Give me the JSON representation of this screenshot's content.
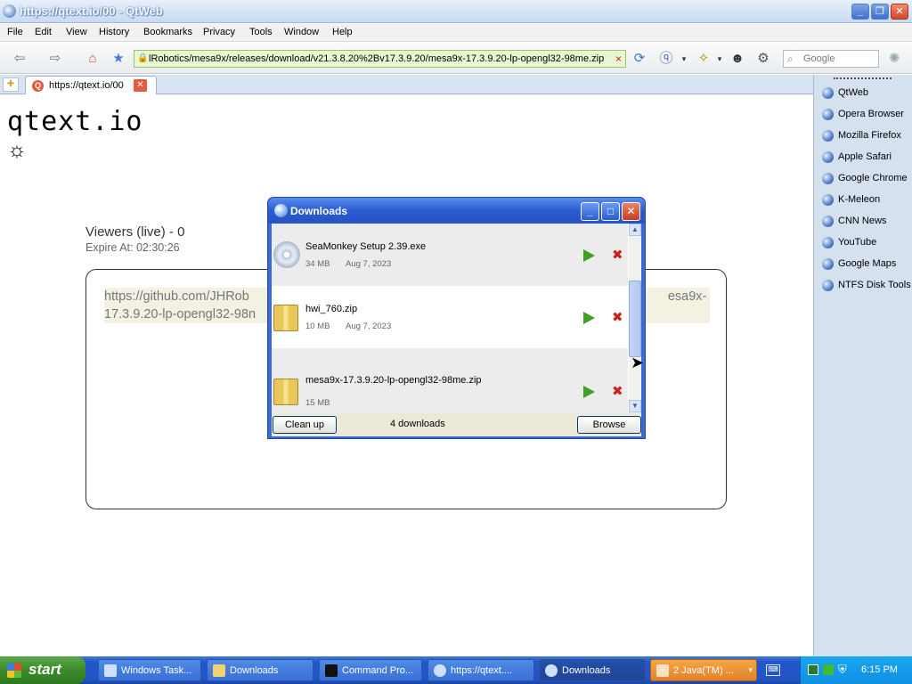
{
  "window": {
    "title": "https://qtext.io/00 - QtWeb"
  },
  "menu": [
    "File",
    "Edit",
    "View",
    "History",
    "Bookmarks",
    "Privacy",
    "Tools",
    "Window",
    "Help"
  ],
  "toolbar": {
    "url": "lRobotics/mesa9x/releases/download/v21.3.8.20%2Bv17.3.9.20/mesa9x-17.3.9.20-lp-opengl32-98me.zip",
    "search_placeholder": "Google"
  },
  "tabs": [
    {
      "label": "https://qtext.io/00"
    }
  ],
  "page": {
    "site_title": "qtext.io",
    "viewers": "Viewers (live) - 0",
    "expire": "Expire At: 02:30:26",
    "text_visible_left": "https://github.com/JHRob",
    "text_visible_right": "esa9x-",
    "text_line2": "17.3.9.20-lp-opengl32-98n"
  },
  "sidebar": [
    "QtWeb",
    "Opera Browser",
    "Mozilla Firefox",
    "Apple Safari",
    "Google Chrome",
    "K-Meleon",
    "CNN News",
    "YouTube",
    "Google Maps",
    "NTFS Disk Tools"
  ],
  "downloads": {
    "title": "Downloads",
    "items": [
      {
        "name": "SeaMonkey Setup 2.39.exe",
        "size": "34 MB",
        "date": "Aug 7, 2023",
        "icon": "installer-cd-icon"
      },
      {
        "name": "hwi_760.zip",
        "size": "10 MB",
        "date": "Aug 7, 2023",
        "icon": "zip-icon"
      },
      {
        "name": "mesa9x-17.3.9.20-lp-opengl32-98me.zip",
        "size": "15 MB",
        "date": "",
        "icon": "zip-icon"
      }
    ],
    "cleanup_label": "Clean up",
    "count": "4 downloads",
    "browse_label": "Browse"
  },
  "taskbar": {
    "start_label": "start",
    "items": [
      "Windows Task...",
      "Downloads",
      "Command Pro...",
      "https://qtext....",
      "Downloads",
      "2 Java(TM) ..."
    ],
    "clock": "6:15 PM"
  }
}
